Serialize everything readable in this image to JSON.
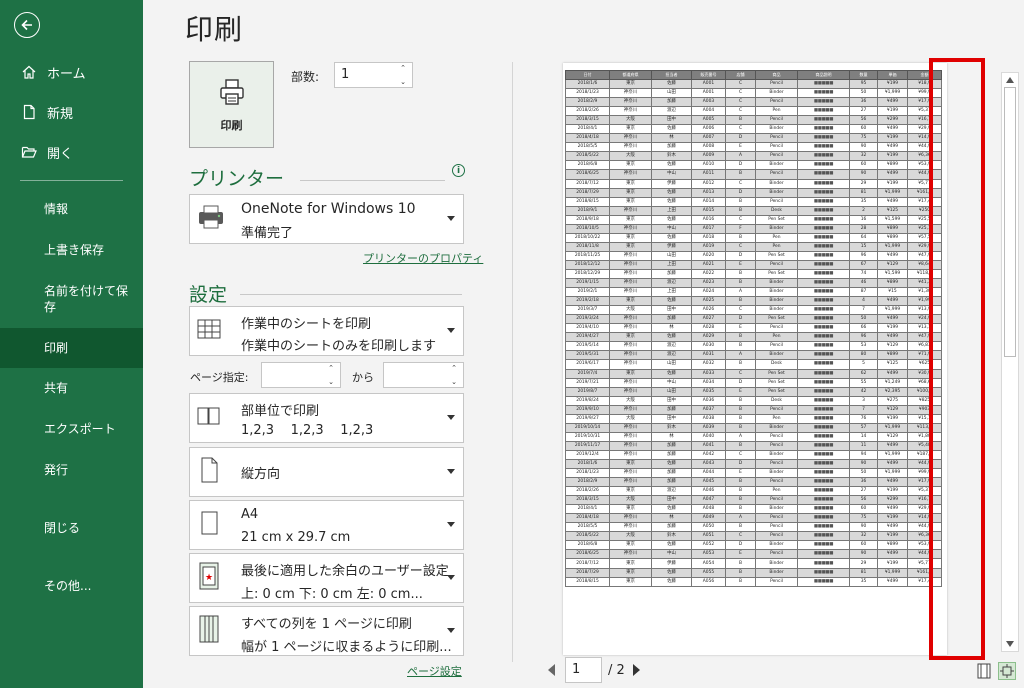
{
  "sidebar": {
    "top_items": [
      {
        "label": "ホーム",
        "icon": "home-icon"
      },
      {
        "label": "新規",
        "icon": "new-document-icon"
      },
      {
        "label": "開く",
        "icon": "folder-open-icon"
      }
    ],
    "items": [
      {
        "label": "情報"
      },
      {
        "label": "上書き保存"
      },
      {
        "label": "名前を付けて保存"
      },
      {
        "label": "印刷",
        "active": true
      },
      {
        "label": "共有"
      },
      {
        "label": "エクスポート"
      },
      {
        "label": "発行"
      },
      {
        "label": "閉じる"
      },
      {
        "label": "その他..."
      }
    ]
  },
  "page": {
    "title": "印刷",
    "print_button": "印刷",
    "copies_label": "部数:",
    "copies_value": "1"
  },
  "printer": {
    "heading": "プリンター",
    "name": "OneNote for Windows 10",
    "status": "準備完了",
    "properties_link": "プリンターのプロパティ"
  },
  "settings": {
    "heading": "設定",
    "scope": {
      "line1": "作業中のシートを印刷",
      "line2": "作業中のシートのみを印刷します"
    },
    "pages_label": "ページ指定:",
    "pages_to": "から",
    "collate": {
      "line1": "部単位で印刷",
      "line2": "1,2,3    1,2,3    1,2,3"
    },
    "orientation": {
      "line1": "縦方向"
    },
    "paper": {
      "line1": "A4",
      "line2": "21 cm x 29.7 cm"
    },
    "margins": {
      "line1": "最後に適用した余白のユーザー設定",
      "line2": "上: 0 cm 下: 0 cm 左: 0 cm..."
    },
    "scaling": {
      "line1": "すべての列を 1 ページに印刷",
      "line2": "幅が 1 ページに収まるように印刷..."
    },
    "page_setup_link": "ページ設定"
  },
  "preview": {
    "current_page": "1",
    "total_pages": "/ 2",
    "headers": [
      "日付",
      "都道府県",
      "担当者",
      "販売番号",
      "店舗",
      "商品",
      "商品説明",
      "数量",
      "単価",
      "金額"
    ],
    "rows": [
      [
        "2018/1/6",
        "東京",
        "佐藤",
        "A001",
        "C",
        "Pencil",
        "■■■■■",
        "95",
        "¥199",
        "¥18,9"
      ],
      [
        "2018/1/23",
        "神奈川",
        "山田",
        "A001",
        "C",
        "Binder",
        "■■■■■",
        "50",
        "¥1,999",
        "¥99,9"
      ],
      [
        "2018/2/9",
        "神奈川",
        "加藤",
        "A003",
        "C",
        "Pencil",
        "■■■■■",
        "36",
        "¥499",
        "¥17,9"
      ],
      [
        "2018/2/26",
        "神奈川",
        "渡辺",
        "A004",
        "C",
        "Pen",
        "■■■■■",
        "27",
        "¥199",
        "¥5,37"
      ],
      [
        "2018/3/15",
        "大阪",
        "田中",
        "A005",
        "B",
        "Pencil",
        "■■■■■",
        "56",
        "¥299",
        "¥16,7"
      ],
      [
        "2018/4/1",
        "東京",
        "佐藤",
        "A006",
        "C",
        "Binder",
        "■■■■■",
        "60",
        "¥499",
        "¥29,9"
      ],
      [
        "2018/4/18",
        "神奈川",
        "林",
        "A007",
        "D",
        "Pencil",
        "■■■■■",
        "75",
        "¥199",
        "¥14,9"
      ],
      [
        "2018/5/5",
        "神奈川",
        "加藤",
        "A008",
        "E",
        "Pencil",
        "■■■■■",
        "90",
        "¥499",
        "¥44,9"
      ],
      [
        "2018/5/22",
        "大阪",
        "鈴木",
        "A009",
        "A",
        "Pencil",
        "■■■■■",
        "32",
        "¥199",
        "¥6,36"
      ],
      [
        "2018/6/8",
        "東京",
        "佐藤",
        "A010",
        "D",
        "Binder",
        "■■■■■",
        "60",
        "¥899",
        "¥53,9"
      ],
      [
        "2018/6/25",
        "神奈川",
        "中山",
        "A011",
        "B",
        "Pencil",
        "■■■■■",
        "90",
        "¥499",
        "¥44,9"
      ],
      [
        "2018/7/12",
        "東京",
        "伊藤",
        "A012",
        "C",
        "Binder",
        "■■■■■",
        "29",
        "¥199",
        "¥5,77"
      ],
      [
        "2018/7/29",
        "東京",
        "佐藤",
        "A013",
        "D",
        "Binder",
        "■■■■■",
        "81",
        "¥1,999",
        "¥161,9"
      ],
      [
        "2018/8/15",
        "東京",
        "佐藤",
        "A014",
        "B",
        "Pencil",
        "■■■■■",
        "35",
        "¥499",
        "¥17,4"
      ],
      [
        "2018/9/1",
        "神奈川",
        "上田",
        "A015",
        "B",
        "Desk",
        "■■■■■",
        "2",
        "¥125",
        "¥250"
      ],
      [
        "2018/9/18",
        "東京",
        "佐藤",
        "A016",
        "C",
        "Pen Set",
        "■■■■■",
        "16",
        "¥1,599",
        "¥25,5"
      ],
      [
        "2018/10/5",
        "神奈川",
        "中山",
        "A017",
        "F",
        "Binder",
        "■■■■■",
        "28",
        "¥899",
        "¥25,1"
      ],
      [
        "2018/10/22",
        "東京",
        "佐藤",
        "A018",
        "B",
        "Pen",
        "■■■■■",
        "64",
        "¥899",
        "¥57,5"
      ],
      [
        "2018/11/8",
        "東京",
        "伊藤",
        "A019",
        "C",
        "Pen",
        "■■■■■",
        "15",
        "¥1,999",
        "¥29,9"
      ],
      [
        "2018/11/25",
        "神奈川",
        "山田",
        "A020",
        "D",
        "Pen Set",
        "■■■■■",
        "96",
        "¥499",
        "¥47,9"
      ],
      [
        "2018/12/12",
        "神奈川",
        "上田",
        "A021",
        "E",
        "Pencil",
        "■■■■■",
        "67",
        "¥129",
        "¥8,64"
      ],
      [
        "2018/12/29",
        "神奈川",
        "加藤",
        "A022",
        "B",
        "Pen Set",
        "■■■■■",
        "74",
        "¥1,599",
        "¥118,3"
      ],
      [
        "2019/1/15",
        "神奈川",
        "渡辺",
        "A023",
        "B",
        "Binder",
        "■■■■■",
        "46",
        "¥899",
        "¥41,3"
      ],
      [
        "2019/2/1",
        "神奈川",
        "上田",
        "A024",
        "A",
        "Binder",
        "■■■■■",
        "87",
        "¥15",
        "¥1,30"
      ],
      [
        "2019/2/18",
        "東京",
        "佐藤",
        "A025",
        "B",
        "Binder",
        "■■■■■",
        "4",
        "¥499",
        "¥1,99"
      ],
      [
        "2019/3/7",
        "大阪",
        "田中",
        "A026",
        "C",
        "Binder",
        "■■■■■",
        "7",
        "¥1,999",
        "¥13,9"
      ],
      [
        "2019/3/24",
        "神奈川",
        "加藤",
        "A027",
        "D",
        "Pen Set",
        "■■■■■",
        "50",
        "¥499",
        "¥24,9"
      ],
      [
        "2019/4/10",
        "神奈川",
        "林",
        "A028",
        "E",
        "Pencil",
        "■■■■■",
        "66",
        "¥199",
        "¥13,1"
      ],
      [
        "2019/4/27",
        "東京",
        "佐藤",
        "A029",
        "B",
        "Pen",
        "■■■■■",
        "96",
        "¥499",
        "¥47,9"
      ],
      [
        "2019/5/14",
        "神奈川",
        "渡辺",
        "A030",
        "B",
        "Pencil",
        "■■■■■",
        "53",
        "¥129",
        "¥6,83"
      ],
      [
        "2019/5/31",
        "神奈川",
        "渡辺",
        "A031",
        "A",
        "Binder",
        "■■■■■",
        "80",
        "¥899",
        "¥71,9"
      ],
      [
        "2019/6/17",
        "神奈川",
        "山田",
        "A032",
        "B",
        "Desk",
        "■■■■■",
        "5",
        "¥125",
        "¥625"
      ],
      [
        "2019/7/4",
        "東京",
        "佐藤",
        "A033",
        "C",
        "Pen Set",
        "■■■■■",
        "62",
        "¥499",
        "¥30,9"
      ],
      [
        "2019/7/21",
        "神奈川",
        "中山",
        "A034",
        "D",
        "Pen Set",
        "■■■■■",
        "55",
        "¥1,249",
        "¥68,6"
      ],
      [
        "2019/8/7",
        "神奈川",
        "山田",
        "A035",
        "E",
        "Pen Set",
        "■■■■■",
        "42",
        "¥2,395",
        "¥100,5"
      ],
      [
        "2019/8/24",
        "大阪",
        "田中",
        "A036",
        "B",
        "Desk",
        "■■■■■",
        "3",
        "¥275",
        "¥825"
      ],
      [
        "2019/9/10",
        "神奈川",
        "加藤",
        "A037",
        "B",
        "Pencil",
        "■■■■■",
        "7",
        "¥129",
        "¥903"
      ],
      [
        "2019/9/27",
        "大阪",
        "田中",
        "A038",
        "B",
        "Pen",
        "■■■■■",
        "76",
        "¥199",
        "¥15,1"
      ],
      [
        "2019/10/14",
        "神奈川",
        "鈴木",
        "A039",
        "B",
        "Binder",
        "■■■■■",
        "57",
        "¥1,999",
        "¥113,9"
      ],
      [
        "2019/10/31",
        "神奈川",
        "林",
        "A040",
        "A",
        "Pencil",
        "■■■■■",
        "14",
        "¥129",
        "¥1,80"
      ],
      [
        "2019/11/17",
        "神奈川",
        "加藤",
        "A041",
        "B",
        "Pencil",
        "■■■■■",
        "11",
        "¥499",
        "¥5,48"
      ],
      [
        "2019/12/4",
        "神奈川",
        "加藤",
        "A042",
        "C",
        "Binder",
        "■■■■■",
        "94",
        "¥1,999",
        "¥187,9"
      ],
      [
        "2018/1/6",
        "東京",
        "佐藤",
        "A043",
        "D",
        "Pencil",
        "■■■■■",
        "90",
        "¥499",
        "¥44,9"
      ],
      [
        "2018/1/23",
        "神奈川",
        "加藤",
        "A044",
        "E",
        "Binder",
        "■■■■■",
        "50",
        "¥1,999",
        "¥99,9"
      ],
      [
        "2018/2/9",
        "神奈川",
        "加藤",
        "A045",
        "B",
        "Pencil",
        "■■■■■",
        "36",
        "¥499",
        "¥17,9"
      ],
      [
        "2018/2/26",
        "東京",
        "渡辺",
        "A046",
        "B",
        "Pen",
        "■■■■■",
        "27",
        "¥199",
        "¥5,37"
      ],
      [
        "2018/3/15",
        "大阪",
        "田中",
        "A047",
        "B",
        "Pencil",
        "■■■■■",
        "56",
        "¥299",
        "¥16,7"
      ],
      [
        "2018/4/1",
        "東京",
        "佐藤",
        "A048",
        "B",
        "Binder",
        "■■■■■",
        "60",
        "¥499",
        "¥29,9"
      ],
      [
        "2018/4/18",
        "神奈川",
        "林",
        "A049",
        "A",
        "Pencil",
        "■■■■■",
        "75",
        "¥199",
        "¥14,9"
      ],
      [
        "2018/5/5",
        "神奈川",
        "加藤",
        "A050",
        "B",
        "Pencil",
        "■■■■■",
        "90",
        "¥499",
        "¥44,9"
      ],
      [
        "2018/5/22",
        "大阪",
        "鈴木",
        "A051",
        "C",
        "Pencil",
        "■■■■■",
        "32",
        "¥199",
        "¥6,36"
      ],
      [
        "2018/6/8",
        "東京",
        "佐藤",
        "A052",
        "D",
        "Binder",
        "■■■■■",
        "60",
        "¥899",
        "¥53,9"
      ],
      [
        "2018/6/25",
        "神奈川",
        "中山",
        "A053",
        "E",
        "Pencil",
        "■■■■■",
        "90",
        "¥499",
        "¥44,9"
      ],
      [
        "2018/7/12",
        "東京",
        "伊藤",
        "A054",
        "B",
        "Binder",
        "■■■■■",
        "29",
        "¥199",
        "¥5,77"
      ],
      [
        "2018/7/29",
        "東京",
        "佐藤",
        "A055",
        "B",
        "Binder",
        "■■■■■",
        "81",
        "¥1,999",
        "¥161,9"
      ],
      [
        "2018/8/15",
        "東京",
        "佐藤",
        "A056",
        "B",
        "Pencil",
        "■■■■■",
        "35",
        "¥499",
        "¥17,4"
      ]
    ]
  },
  "colors": {
    "sidebar_bg": "#1e7145",
    "sidebar_active": "#10572f",
    "accent_green": "#1e6e3e",
    "highlight_red": "#e00000"
  }
}
